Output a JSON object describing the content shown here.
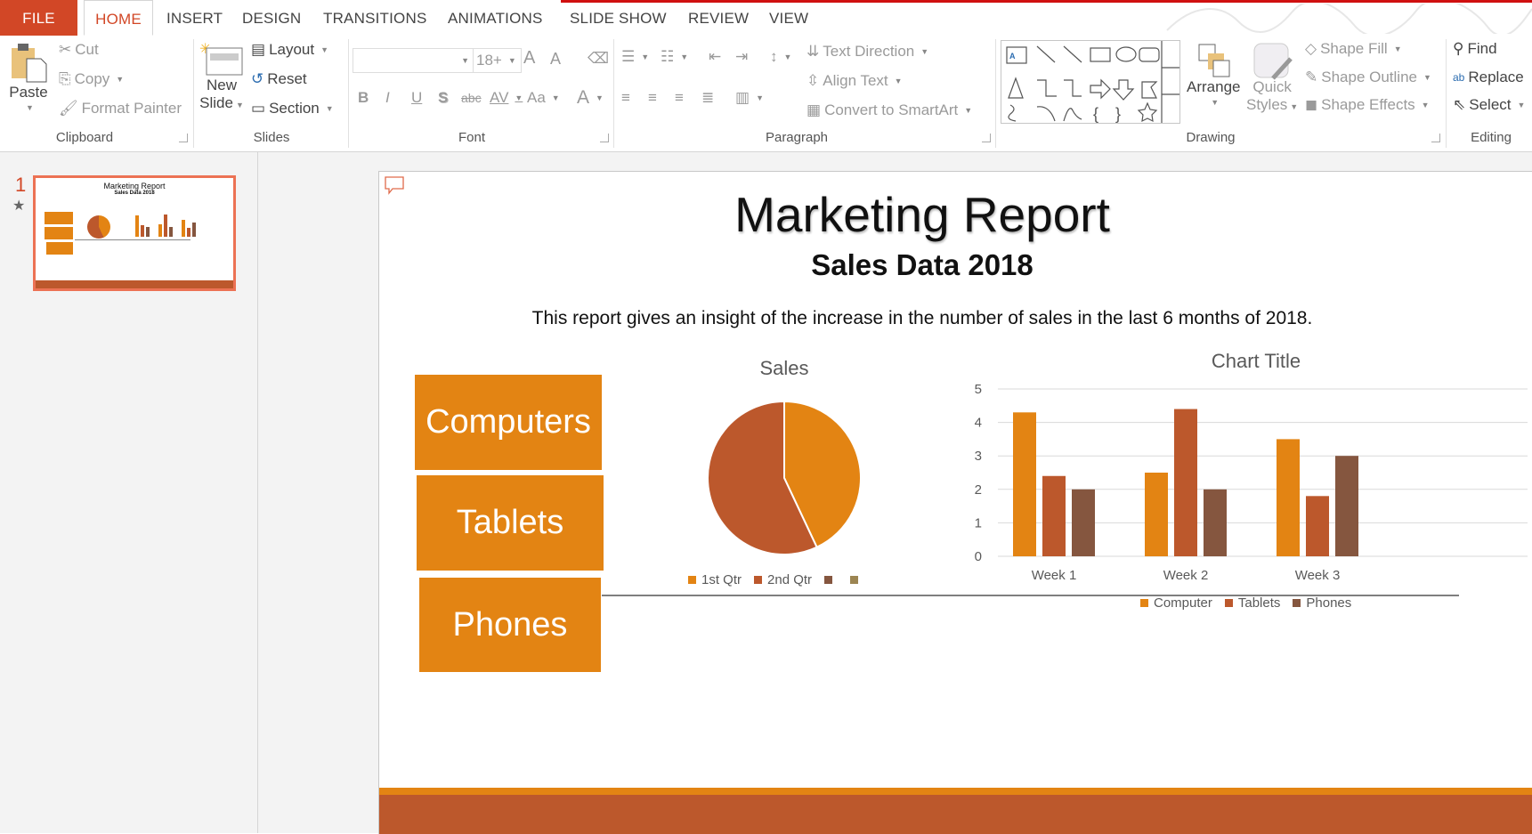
{
  "tabs": [
    {
      "label": "FILE"
    },
    {
      "label": "HOME"
    },
    {
      "label": "INSERT"
    },
    {
      "label": "DESIGN"
    },
    {
      "label": "TRANSITIONS"
    },
    {
      "label": "ANIMATIONS"
    },
    {
      "label": "SLIDE SHOW"
    },
    {
      "label": "REVIEW"
    },
    {
      "label": "VIEW"
    }
  ],
  "ribbon": {
    "clipboard": {
      "label": "Clipboard",
      "paste": "Paste",
      "cut": "Cut",
      "copy": "Copy",
      "format_painter": "Format Painter"
    },
    "slides": {
      "label": "Slides",
      "new_slide_1": "New",
      "new_slide_2": "Slide",
      "layout": "Layout",
      "reset": "Reset",
      "section": "Section"
    },
    "font": {
      "label": "Font",
      "font_name": "",
      "font_size": "18+",
      "bold": "B",
      "italic": "I",
      "underline": "U",
      "shadow": "S",
      "strike": "abc",
      "spacing": "AV",
      "case": "Aa",
      "color": "A",
      "grow": "A",
      "shrink": "A"
    },
    "paragraph": {
      "label": "Paragraph",
      "text_direction": "Text Direction",
      "align_text": "Align Text",
      "convert_smartart": "Convert to SmartArt"
    },
    "drawing": {
      "label": "Drawing",
      "arrange": "Arrange",
      "quick_styles_1": "Quick",
      "quick_styles_2": "Styles",
      "shape_fill": "Shape Fill",
      "shape_outline": "Shape Outline",
      "shape_effects": "Shape Effects"
    },
    "editing": {
      "label": "Editing",
      "find": "Find",
      "replace": "Replace",
      "select": "Select"
    }
  },
  "slide_panel": {
    "slide_number": "1"
  },
  "slide": {
    "title": "Marketing Report",
    "subtitle": "Sales Data 2018",
    "body": "This report gives an insight of the increase in the number of sales in the last 6 months of 2018.",
    "boxes": [
      "Computers",
      "Tablets",
      "Phones"
    ],
    "colors": {
      "orange": "#e38413",
      "rust": "#bc582c",
      "brown": "#85563f",
      "khaki": "#9c8552"
    }
  },
  "chart_data": [
    {
      "type": "pie",
      "title": "Sales",
      "categories": [
        "1st Qtr",
        "2nd Qtr",
        "",
        ""
      ],
      "values": [
        4.3,
        5.7,
        0,
        0
      ],
      "colors": [
        "#e38413",
        "#bc582c",
        "#85563f",
        "#9c8552"
      ],
      "legend": "bottom"
    },
    {
      "type": "bar",
      "title": "Chart Title",
      "categories": [
        "Week 1",
        "Week 2",
        "Week 3"
      ],
      "series": [
        {
          "name": "Computer",
          "values": [
            4.3,
            2.5,
            3.5
          ],
          "color": "#e38413"
        },
        {
          "name": "Tablets",
          "values": [
            2.4,
            4.4,
            1.8
          ],
          "color": "#bc582c"
        },
        {
          "name": "Phones",
          "values": [
            2,
            2,
            3
          ],
          "color": "#85563f"
        }
      ],
      "yticks": [
        "0",
        "1",
        "2",
        "3",
        "4",
        "5"
      ],
      "ylim": [
        0,
        5
      ],
      "grid": true,
      "legend": "bottom"
    }
  ]
}
